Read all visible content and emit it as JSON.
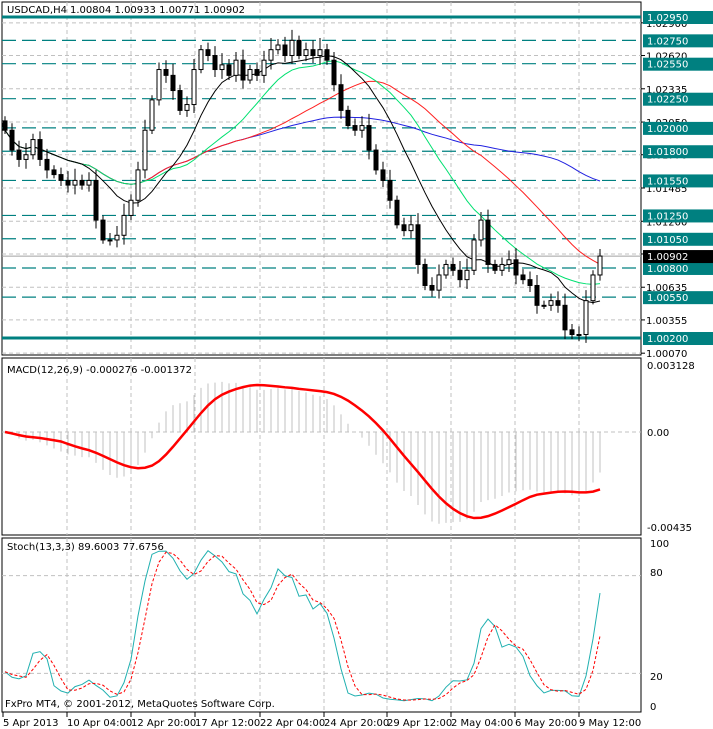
{
  "header": {
    "symbol_label": "USDCAD,H4",
    "ohlc": "1.00804 1.00933 1.00771 1.00902"
  },
  "footer": {
    "copyright": "FxPro MT4, © 2001-2012, MetaQuotes Software Corp."
  },
  "colors": {
    "level": "#008080",
    "bull_body": "#ffffff",
    "bear_body": "#000000",
    "ma_fast": "#000000",
    "ma_mid": "#00e070",
    "ma_slow": "#ff2020",
    "ma_long": "#2020e0",
    "macd_signal": "#ff0000",
    "macd_hist": "#c0c0c0",
    "stoch_main": "#20b0b0",
    "stoch_signal": "#ff0000",
    "grid": "#c0c0c0"
  },
  "chart_data": [
    {
      "type": "candlestick",
      "title": "USDCAD,H4",
      "ylim": [
        1.0007,
        1.0297
      ],
      "price_ticks": [
        "1.02900",
        "1.02620",
        "1.02335",
        "1.02050",
        "1.01770",
        "1.01485",
        "1.01200",
        "1.00920",
        "1.00635",
        "1.00355",
        "1.00070"
      ],
      "levels": [
        {
          "label": "1.02950",
          "value": 1.0295,
          "bold": true
        },
        {
          "label": "1.02750",
          "value": 1.0275
        },
        {
          "label": "1.02550",
          "value": 1.0255
        },
        {
          "label": "1.02250",
          "value": 1.0225
        },
        {
          "label": "1.02000",
          "value": 1.02
        },
        {
          "label": "1.01800",
          "value": 1.018
        },
        {
          "label": "1.01550",
          "value": 1.0155
        },
        {
          "label": "1.01250",
          "value": 1.0125
        },
        {
          "label": "1.01050",
          "value": 1.0105
        },
        {
          "label": "1.00800",
          "value": 1.008
        },
        {
          "label": "1.00550",
          "value": 1.0055
        },
        {
          "label": "1.00200",
          "value": 1.002,
          "bold": true
        }
      ],
      "current_price": {
        "label": "1.00902",
        "value": 1.00902
      },
      "closes": [
        1.0198,
        1.0181,
        1.0173,
        1.0177,
        1.019,
        1.0173,
        1.0164,
        1.016,
        1.0155,
        1.0151,
        1.0155,
        1.0151,
        1.0155,
        1.0121,
        1.0104,
        1.0104,
        1.0108,
        1.0125,
        1.0138,
        1.0164,
        1.0198,
        1.0224,
        1.025,
        1.0245,
        1.0232,
        1.0215,
        1.022,
        1.025,
        1.0267,
        1.0262,
        1.025,
        1.0254,
        1.0245,
        1.0258,
        1.0241,
        1.025,
        1.0245,
        1.0258,
        1.0267,
        1.0271,
        1.0262,
        1.0275,
        1.0262,
        1.0267,
        1.0262,
        1.0267,
        1.0258,
        1.0237,
        1.0215,
        1.0202,
        1.0198,
        1.0202,
        1.0181,
        1.0164,
        1.0155,
        1.0138,
        1.0117,
        1.0112,
        1.0117,
        1.0083,
        1.0065,
        1.0061,
        1.0074,
        1.0083,
        1.0078,
        1.007,
        1.0078,
        1.0104,
        1.0121,
        1.0083,
        1.0078,
        1.0083,
        1.0087,
        1.0074,
        1.007,
        1.0065,
        1.0048,
        1.0048,
        1.0052,
        1.0048,
        1.0027,
        1.0023,
        1.0023,
        1.0052,
        1.0074,
        1.00902
      ],
      "time_labels": [
        "5 Apr 2013",
        "10 Apr 04:00",
        "12 Apr 20:00",
        "17 Apr 12:00",
        "22 Apr 04:00",
        "24 Apr 20:00",
        "29 Apr 12:00",
        "2 May 04:00",
        "6 May 20:00",
        "9 May 12:00"
      ]
    },
    {
      "type": "bar+line",
      "title": "MACD(12,26,9) -0.000276 -0.001372",
      "ylim": [
        -0.00435,
        0.003128
      ],
      "tick_labels": [
        "0.003128",
        "0.00",
        "-0.00435"
      ]
    },
    {
      "type": "line",
      "title": "Stoch(13,3,3) 89.6003 77.6756",
      "ylim": [
        0,
        100
      ],
      "tick_labels": [
        "100",
        "80",
        "20",
        "0"
      ],
      "levels": [
        80,
        20
      ]
    }
  ]
}
